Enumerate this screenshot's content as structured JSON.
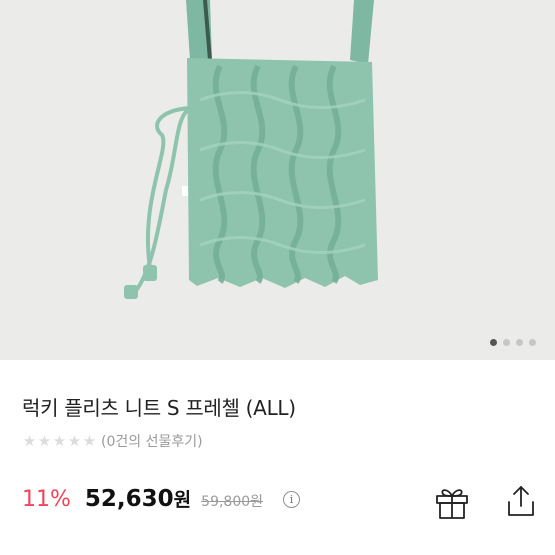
{
  "product": {
    "title": "럭키 플리츠 니트 S 프레첼 (ALL)",
    "review_text": "(0건의 선물후기)",
    "rating": {
      "value": 0,
      "max": 5
    },
    "discount": "11%",
    "price": "52,630",
    "price_unit": "원",
    "original_price": "59,800원"
  },
  "gallery": {
    "image": "mint-knit-pleats-bag",
    "total": 4,
    "current": 1
  },
  "icons": {
    "info": "i",
    "gift": "gift-icon",
    "share": "share-icon"
  },
  "colors": {
    "discount": "#f0445a",
    "bag": "#8ec4ae",
    "background": "#ebebea"
  }
}
